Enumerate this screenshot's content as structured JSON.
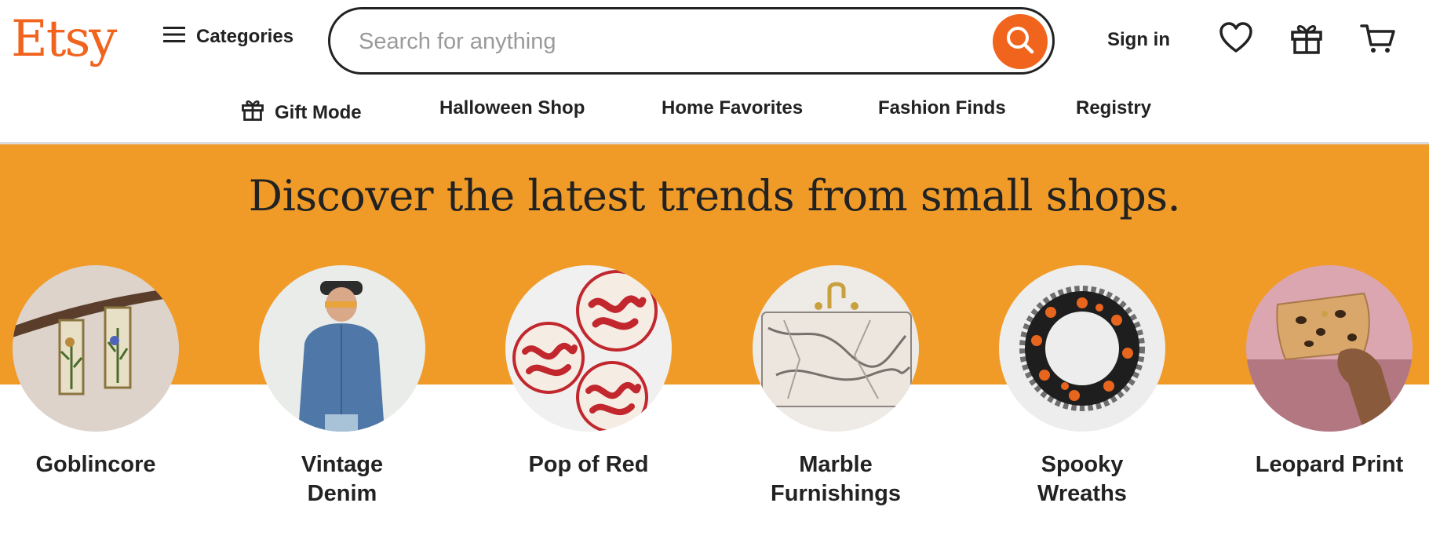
{
  "header": {
    "logo": "Etsy",
    "categories_label": "Categories",
    "search_placeholder": "Search for anything",
    "search_value": "",
    "signin_label": "Sign in",
    "icons": [
      "menu-icon",
      "search-icon",
      "heart-icon",
      "gift-icon",
      "cart-icon"
    ]
  },
  "nav": {
    "items": [
      {
        "label": "Gift Mode",
        "icon": "gift-icon"
      },
      {
        "label": "Halloween Shop"
      },
      {
        "label": "Home Favorites"
      },
      {
        "label": "Fashion Finds"
      },
      {
        "label": "Registry"
      }
    ]
  },
  "banner": {
    "headline": "Discover the latest trends from small shops.",
    "color": "#f09b28"
  },
  "trends": [
    {
      "line1": "Goblincore",
      "line2": ""
    },
    {
      "line1": "Vintage",
      "line2": "Denim"
    },
    {
      "line1": "Pop of Red",
      "line2": ""
    },
    {
      "line1": "Marble",
      "line2": "Furnishings"
    },
    {
      "line1": "Spooky",
      "line2": "Wreaths"
    },
    {
      "line1": "Leopard Print",
      "line2": ""
    }
  ],
  "colors": {
    "accent": "#f1641e",
    "text": "#222222"
  }
}
